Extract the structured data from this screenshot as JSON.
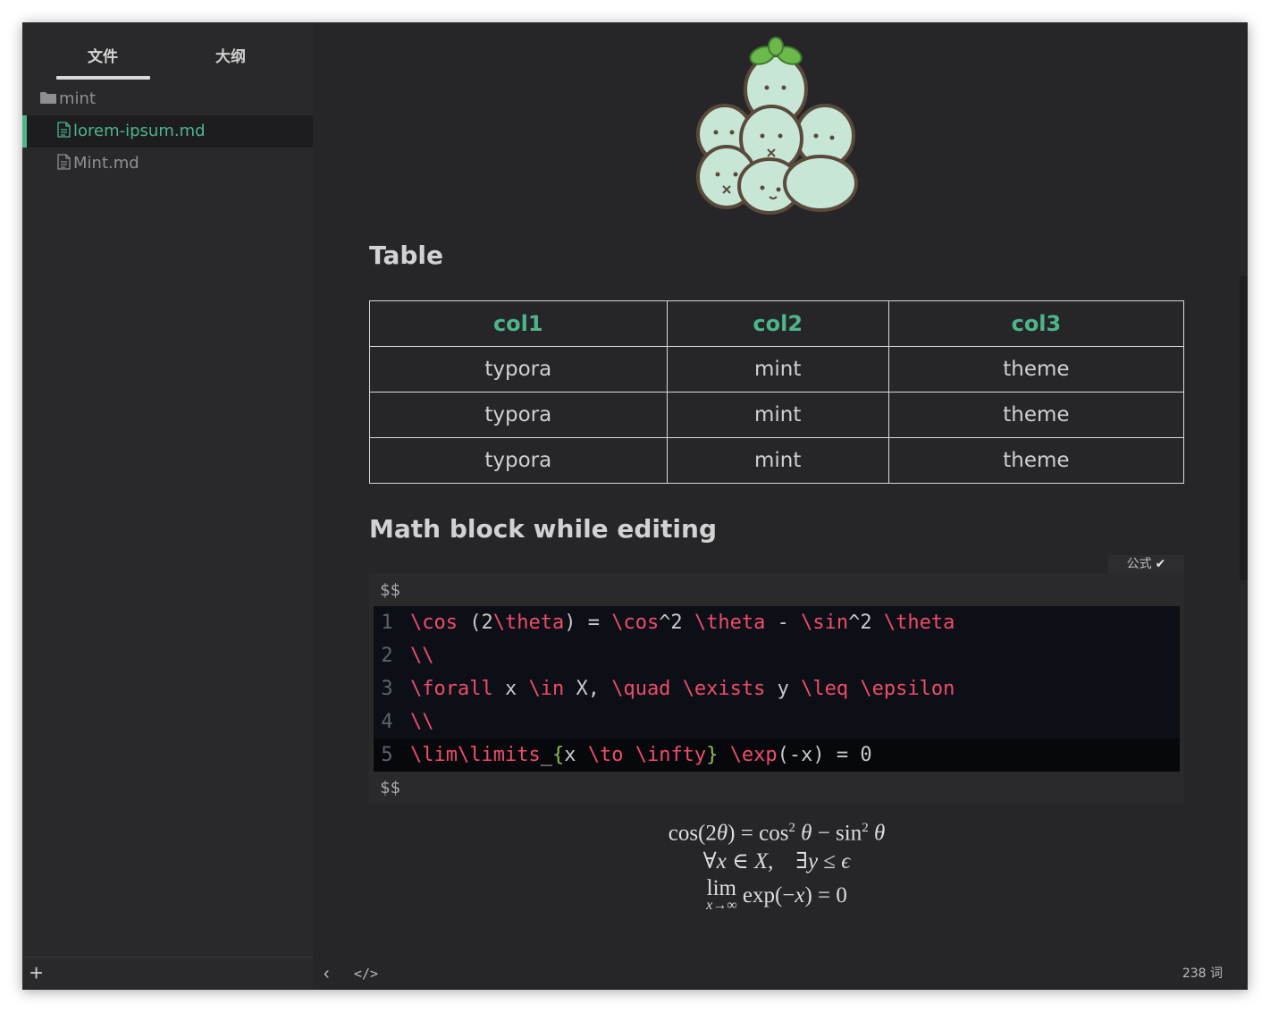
{
  "sidebar": {
    "tabs": [
      {
        "label": "文件"
      },
      {
        "label": "大纲"
      }
    ],
    "folder": {
      "name": "mint"
    },
    "files": [
      {
        "name": "lorem-ipsum.md",
        "active": true
      },
      {
        "name": "Mint.md",
        "active": false
      }
    ],
    "add_label": "+"
  },
  "editor": {
    "table_heading": "Table",
    "table": {
      "headers": [
        "col1",
        "col2",
        "col3"
      ],
      "rows": [
        [
          "typora",
          "mint",
          "theme"
        ],
        [
          "typora",
          "mint",
          "theme"
        ],
        [
          "typora",
          "mint",
          "theme"
        ]
      ]
    },
    "math_heading": "Math block while editing",
    "math_label": "公式",
    "math_delim": "$$",
    "code_lines": [
      "1",
      "2",
      "3",
      "4",
      "5"
    ]
  },
  "statusbar": {
    "word_count": "238 词"
  },
  "colors": {
    "accent": "#4db58a",
    "latex_command": "#ef4c6c",
    "background": "#262629"
  },
  "icons": [
    "folder-icon",
    "file-icon",
    "check-icon",
    "chevron-left-icon",
    "code-icon",
    "plus-icon"
  ]
}
